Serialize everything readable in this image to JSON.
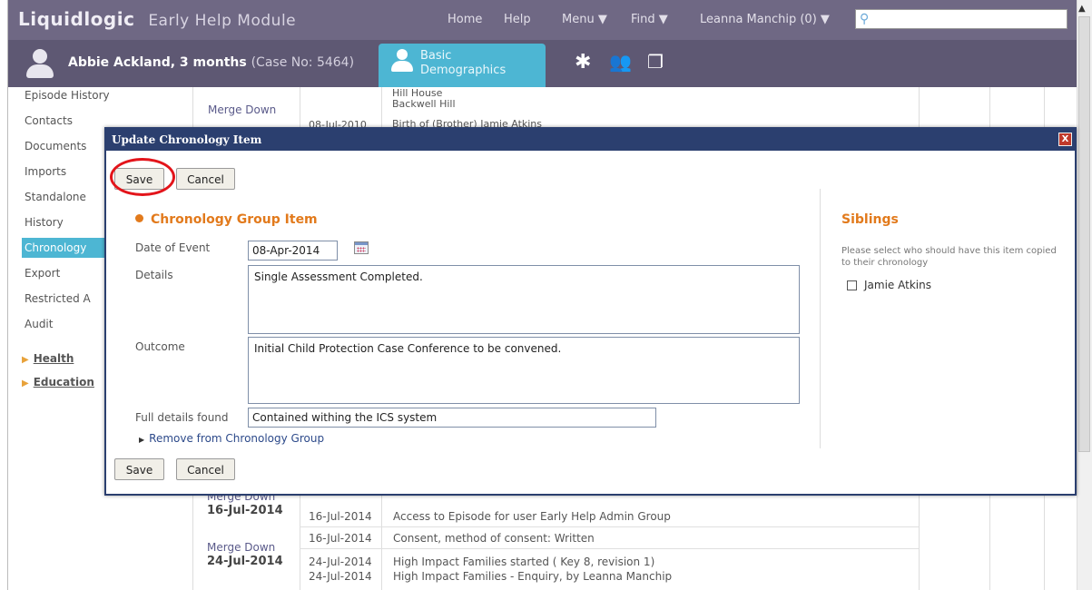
{
  "header": {
    "brand": "Liquidlogic",
    "module": "Early Help Module",
    "nav": [
      "Home",
      "Help",
      "Menu ▼",
      "Find ▼",
      "Leanna Manchip (0) ▼"
    ]
  },
  "case": {
    "name": "Abbie Ackland, 3 months",
    "case_no": "(Case No: 5464)",
    "active_tab": "Basic Demographics"
  },
  "sidebar": {
    "items": [
      "Episode History",
      "Contacts",
      "Documents",
      "Imports",
      "Standalone",
      "History",
      "Chronology",
      "Export",
      "Restricted A",
      "Audit"
    ],
    "groups": [
      "Health",
      "Education"
    ]
  },
  "background": {
    "top_link": "Merge Down",
    "top_details": [
      "Hill House",
      "Backwell Hill",
      "Birth of (Brother) Jamie Atkins"
    ],
    "partial_date": "08-Jul-2010",
    "rows": [
      {
        "merge": "Merge Down",
        "group_date": "16-Jul-2014",
        "date1": "16-Jul-2014",
        "text1": "Access to Episode for user Early Help Admin Group",
        "date2": "16-Jul-2014",
        "text2": "Consent, method of consent: Written"
      },
      {
        "merge": "Merge Down",
        "group_date": "24-Jul-2014",
        "date1": "24-Jul-2014",
        "text1": "High Impact Families started ( Key 8, revision 1)",
        "date2": "24-Jul-2014",
        "text2": "High Impact Families - Enquiry, by Leanna Manchip"
      }
    ]
  },
  "modal": {
    "title": "Update Chronology Item",
    "close": "X",
    "save_label": "Save",
    "cancel_label": "Cancel",
    "section_title": "Chronology Group Item",
    "date_label": "Date of Event",
    "date_value": "08-Apr-2014",
    "details_label": "Details",
    "details_value": "Single Assessment Completed.",
    "outcome_label": "Outcome",
    "outcome_value": "Initial Child Protection Case Conference to be convened.",
    "full_details_label": "Full details found",
    "full_details_value": "Contained withing the ICS system",
    "remove_link": "Remove from Chronology Group",
    "siblings_title": "Siblings",
    "siblings_note": "Please select who should have this item copied to their chronology",
    "sibling_name": "Jamie Atkins"
  },
  "colors": {
    "topbar": "#6f6884",
    "casebar": "#5e5873",
    "accent": "#4db6d3",
    "modal_header": "#2b3f6f",
    "section_orange": "#e27a1c",
    "highlight_red": "#e3141a"
  }
}
